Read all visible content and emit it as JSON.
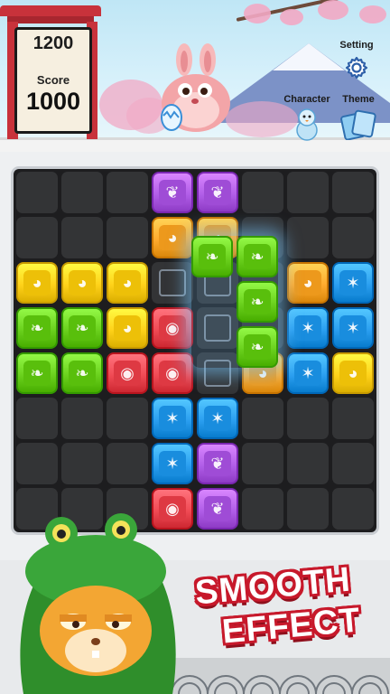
{
  "header": {
    "best_score": "1200",
    "score_label": "Score",
    "score_value": "1000",
    "setting_label": "Setting",
    "character_label": "Character",
    "theme_label": "Theme",
    "setting_icon": "gear-icon",
    "character_icon": "snowman-icon",
    "theme_icon": "cards-icon"
  },
  "colors": {
    "purple": "#b15ee8",
    "orange": "#ffab2e",
    "green": "#6bd11e",
    "yellow": "#ffd21a",
    "red": "#f04b55",
    "blue": "#2b9ff0",
    "board_bg": "#1d1d1f",
    "empty_cell": "#333436",
    "promo_red": "#c7192b"
  },
  "board": {
    "rows": 8,
    "cols": 8,
    "grid": [
      [
        "",
        "",
        "",
        "purple",
        "purple",
        "",
        "",
        ""
      ],
      [
        "",
        "",
        "",
        "orange",
        "orange",
        "",
        "",
        ""
      ],
      [
        "yellow",
        "yellow",
        "yellow",
        "",
        "",
        "",
        "orange",
        "blue"
      ],
      [
        "green",
        "green",
        "yellow",
        "red",
        "",
        "",
        "blue",
        "blue"
      ],
      [
        "green",
        "green",
        "red",
        "red",
        "",
        "orange",
        "blue",
        "yellow"
      ],
      [
        "",
        "",
        "",
        "blue",
        "blue",
        "",
        "",
        ""
      ],
      [
        "",
        "",
        "",
        "blue",
        "purple",
        "",
        "",
        ""
      ],
      [
        "",
        "",
        "",
        "red",
        "purple",
        "",
        "",
        ""
      ]
    ],
    "ghost_cells": [
      [
        2,
        3
      ],
      [
        2,
        4
      ],
      [
        3,
        4
      ],
      [
        4,
        4
      ]
    ],
    "dragged_piece": {
      "color": "green",
      "cells": [
        [
          0,
          0
        ],
        [
          0,
          1
        ],
        [
          1,
          1
        ],
        [
          2,
          1
        ]
      ]
    }
  },
  "symbols": {
    "purple": "paw-icon",
    "orange": "cat-face-icon",
    "green": "drumstick-icon",
    "yellow": "cat-face-icon",
    "red": "bear-face-icon",
    "blue": "bone-icon"
  },
  "promo": {
    "line1": "SMOOTH",
    "line2": "EFFECT"
  }
}
